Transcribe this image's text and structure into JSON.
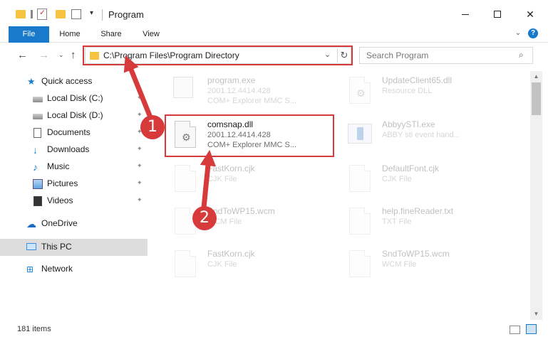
{
  "window": {
    "title": "Program",
    "minimize_icon": "minimize-icon",
    "maximize_icon": "maximize-icon",
    "close_label": "✕"
  },
  "ribbon": {
    "tabs": [
      {
        "label": "File"
      },
      {
        "label": "Home"
      },
      {
        "label": "Share"
      },
      {
        "label": "View"
      }
    ],
    "expand_label": "⌄",
    "help_label": "?"
  },
  "navigation": {
    "back": "←",
    "forward": "→",
    "recent": "⌄",
    "up": "↑",
    "address": "C:\\Program Files\\Program Directory",
    "address_dropdown": "⌄",
    "refresh": "↻",
    "search_placeholder": "Search Program",
    "search_icon": "⌕"
  },
  "sidebar": {
    "items": [
      {
        "label": "Quick access",
        "icon": "star-icon"
      },
      {
        "label": "Local Disk (C:)",
        "icon": "disk-icon",
        "pinned": true
      },
      {
        "label": "Local Disk (D:)",
        "icon": "disk-icon",
        "pinned": true
      },
      {
        "label": "Documents",
        "icon": "document-icon",
        "pinned": true
      },
      {
        "label": "Downloads",
        "icon": "download-icon",
        "pinned": true
      },
      {
        "label": "Music",
        "icon": "music-icon",
        "pinned": true
      },
      {
        "label": "Pictures",
        "icon": "pictures-icon",
        "pinned": true
      },
      {
        "label": "Videos",
        "icon": "video-icon",
        "pinned": true
      },
      {
        "label": "OneDrive",
        "icon": "cloud-icon"
      },
      {
        "label": "This PC",
        "icon": "computer-icon",
        "selected": true
      },
      {
        "label": "Network",
        "icon": "network-icon"
      }
    ],
    "pin_glyph": "📌"
  },
  "files": [
    {
      "name": "program.exe",
      "line2": "2001.12.4414.428",
      "line3": "COM+ Explorer MMC S...",
      "faded": true
    },
    {
      "name": "UpdateClient65.dll",
      "line2": "Resource DLL",
      "line3": "",
      "faded": true
    },
    {
      "name": "comsnap.dll",
      "line2": "2001.12.4414.428",
      "line3": "COM+ Explorer MMC S...",
      "faded": false
    },
    {
      "name": "AbbyySTI.exe",
      "line2": "ABBY sti event hand...",
      "line3": "",
      "faded": true
    },
    {
      "name": "FastKorn.cjk",
      "line2": "CJK File",
      "line3": "",
      "faded": true
    },
    {
      "name": "DefaultFont.cjk",
      "line2": "CJK File",
      "line3": "",
      "faded": true
    },
    {
      "name": "SndToWP15.wcm",
      "line2": "WCM File",
      "line3": "",
      "faded": true
    },
    {
      "name": "help.fineReader.txt",
      "line2": "TXT File",
      "line3": "",
      "faded": true
    },
    {
      "name": "FastKorn.cjk",
      "line2": "CJK File",
      "line3": "",
      "faded": true
    },
    {
      "name": "SndToWP15.wcm",
      "line2": "WCM File",
      "line3": "",
      "faded": true
    }
  ],
  "status": {
    "items_count": "181 items"
  },
  "callouts": {
    "one": "1",
    "two": "2"
  },
  "colors": {
    "accent": "#1979ca",
    "highlight": "#d63a3a",
    "folder": "#f6c343"
  }
}
